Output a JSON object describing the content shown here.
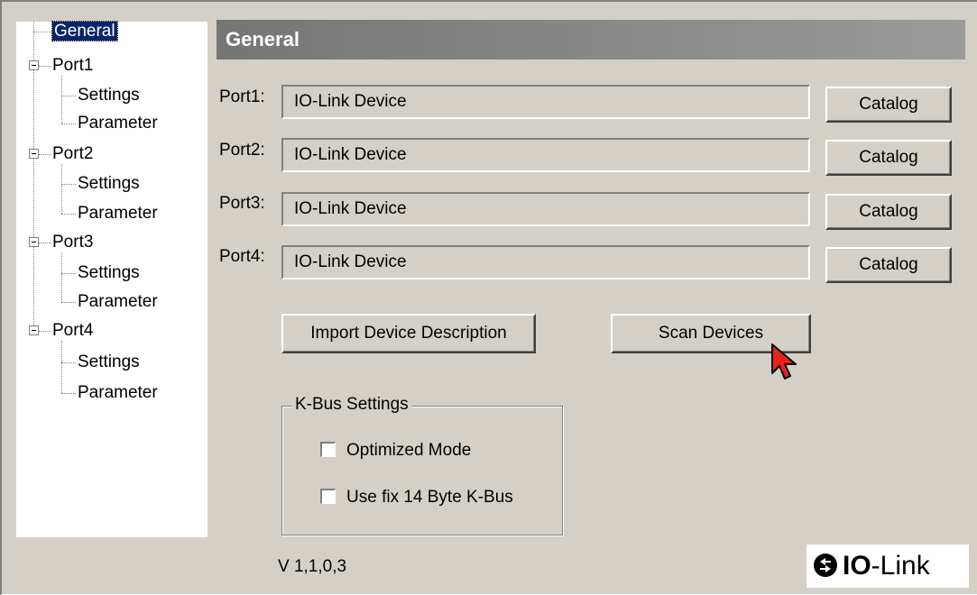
{
  "tree": {
    "general": "General",
    "ports": [
      {
        "label": "Port1",
        "children": [
          "Settings",
          "Parameter"
        ]
      },
      {
        "label": "Port2",
        "children": [
          "Settings",
          "Parameter"
        ]
      },
      {
        "label": "Port3",
        "children": [
          "Settings",
          "Parameter"
        ]
      },
      {
        "label": "Port4",
        "children": [
          "Settings",
          "Parameter"
        ]
      }
    ]
  },
  "main": {
    "title": "General",
    "ports": [
      {
        "label": "Port1:",
        "value": "IO-Link Device",
        "button": "Catalog"
      },
      {
        "label": "Port2:",
        "value": "IO-Link Device",
        "button": "Catalog"
      },
      {
        "label": "Port3:",
        "value": "IO-Link Device",
        "button": "Catalog"
      },
      {
        "label": "Port4:",
        "value": "IO-Link Device",
        "button": "Catalog"
      }
    ],
    "import_button": "Import Device Description",
    "scan_button": "Scan Devices",
    "kbus": {
      "title": "K-Bus Settings",
      "optimized_mode": {
        "label": "Optimized Mode",
        "checked": false
      },
      "fix14": {
        "label": "Use fix 14 Byte K-Bus",
        "checked": false
      }
    },
    "version": "V 1,1,0,3",
    "logo": {
      "bold": "IO",
      "rest": "-Link"
    }
  },
  "colors": {
    "window_bg": "#d4d0c8",
    "header_bg": "#808080",
    "selection": "#0a246a",
    "cursor": "#e8231a"
  }
}
